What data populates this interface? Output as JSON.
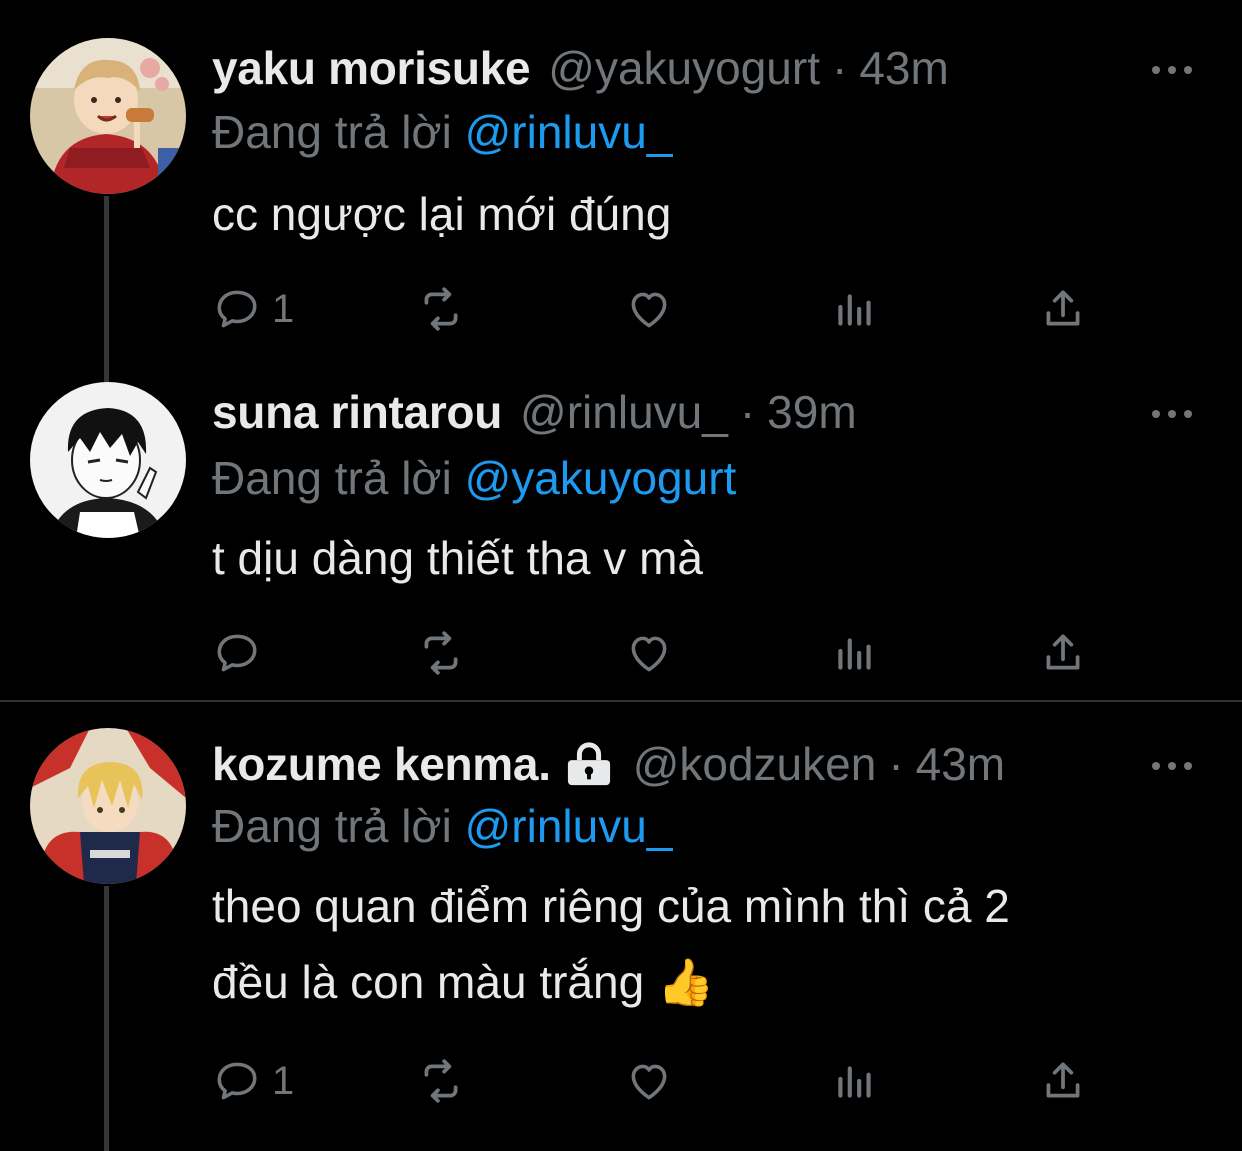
{
  "tweets": [
    {
      "name": "yaku morisuke",
      "handle": "@yakuyogurt",
      "separator": "·",
      "time": "43m",
      "reply_prefix": "Đang trả lời",
      "reply_to": "@rinluvu_",
      "text": "cc ngược lại mới đúng",
      "reply_count": "1",
      "avatar_colors": {
        "bg": "#d8c7a7",
        "scarf": "#b2262a",
        "hair": "#d9b27a"
      }
    },
    {
      "name": "suna rintarou",
      "handle": "@rinluvu_",
      "separator": "·",
      "time": "39m",
      "reply_prefix": "Đang trả lời",
      "reply_to": "@yakuyogurt",
      "text": "t dịu dàng thiết tha v mà",
      "reply_count": "",
      "avatar_colors": {
        "bg": "#f2f2f2",
        "hair": "#111111"
      }
    },
    {
      "name": "kozume kenma.",
      "handle": "@kodzuken",
      "separator": "·",
      "time": "43m",
      "reply_prefix": "Đang trả lời",
      "reply_to": "@rinluvu_",
      "text_line1": "theo quan điểm riêng của mình thì cả 2",
      "text_line2": "đều là con màu trắng 👍",
      "reply_count": "1",
      "avatar_colors": {
        "bg": "#e6d9c3",
        "jacket": "#c8302a",
        "hair": "#e7c35a"
      }
    }
  ],
  "icons": [
    "reply-icon",
    "retweet-icon",
    "like-icon",
    "analytics-icon",
    "share-icon",
    "more-icon",
    "lock-icon"
  ],
  "colors": {
    "background": "#000000",
    "primary_text": "#e7e9ea",
    "secondary_text": "#71767b",
    "link": "#1d9bf0",
    "divider": "#2f3336"
  }
}
